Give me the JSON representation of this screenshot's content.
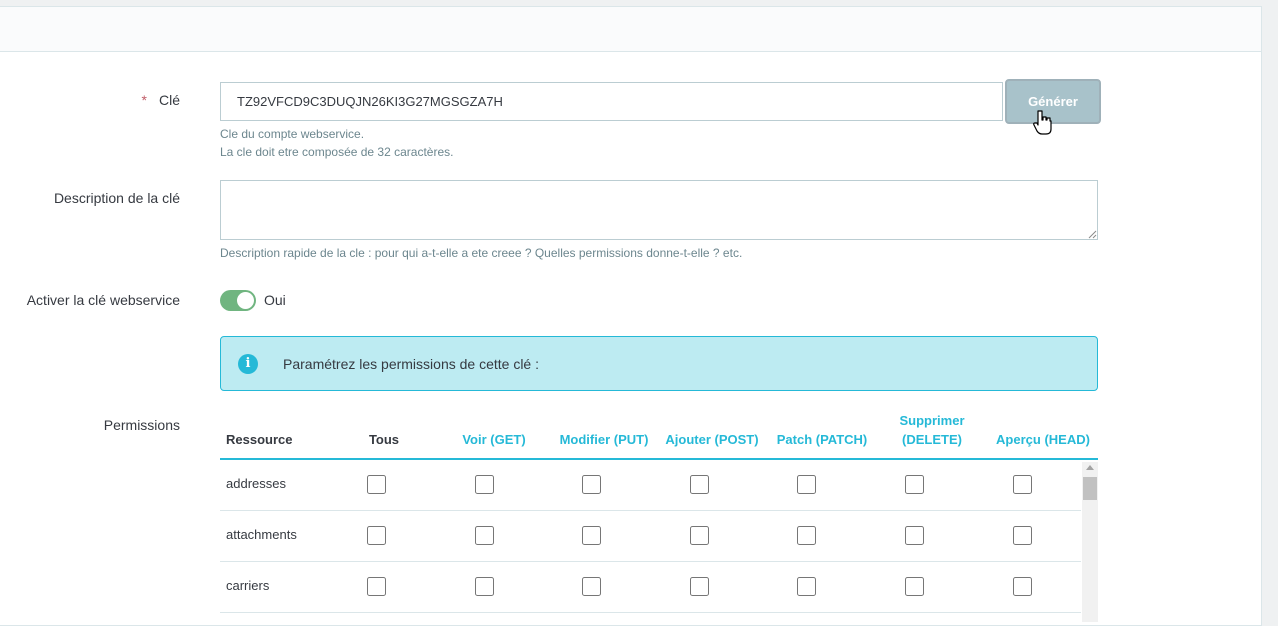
{
  "form": {
    "key": {
      "required_mark": "*",
      "label": "Clé",
      "value": "TZ92VFCD9C3DUQJN26KI3G27MGSGZA7H",
      "generate_label": "Générer",
      "help_line1": "Cle du compte webservice.",
      "help_line2": "La cle doit etre composée de 32 caractères."
    },
    "description": {
      "label": "Description de la clé",
      "value": "",
      "help": "Description rapide de la cle : pour qui a-t-elle a ete creee ? Quelles permissions donne-t-elle ? etc."
    },
    "activate": {
      "label": "Activer la clé webservice",
      "state": "on",
      "value_label": "Oui"
    },
    "alert": {
      "icon": "info-icon",
      "text": "Paramétrez les permissions de cette clé :"
    },
    "permissions": {
      "label": "Permissions",
      "columns": {
        "resource": "Ressource",
        "all": "Tous",
        "get": "Voir (GET)",
        "put": "Modifier (PUT)",
        "post": "Ajouter (POST)",
        "patch": "Patch (PATCH)",
        "delete_line1": "Supprimer",
        "delete_line2": "(DELETE)",
        "head": "Aperçu (HEAD)"
      },
      "rows": [
        {
          "resource": "addresses"
        },
        {
          "resource": "attachments"
        },
        {
          "resource": "carriers"
        }
      ]
    }
  },
  "colors": {
    "accent": "#25b9d7",
    "toggle_on": "#70b580",
    "alert_bg": "#bdebf2",
    "required": "#c05c67"
  }
}
